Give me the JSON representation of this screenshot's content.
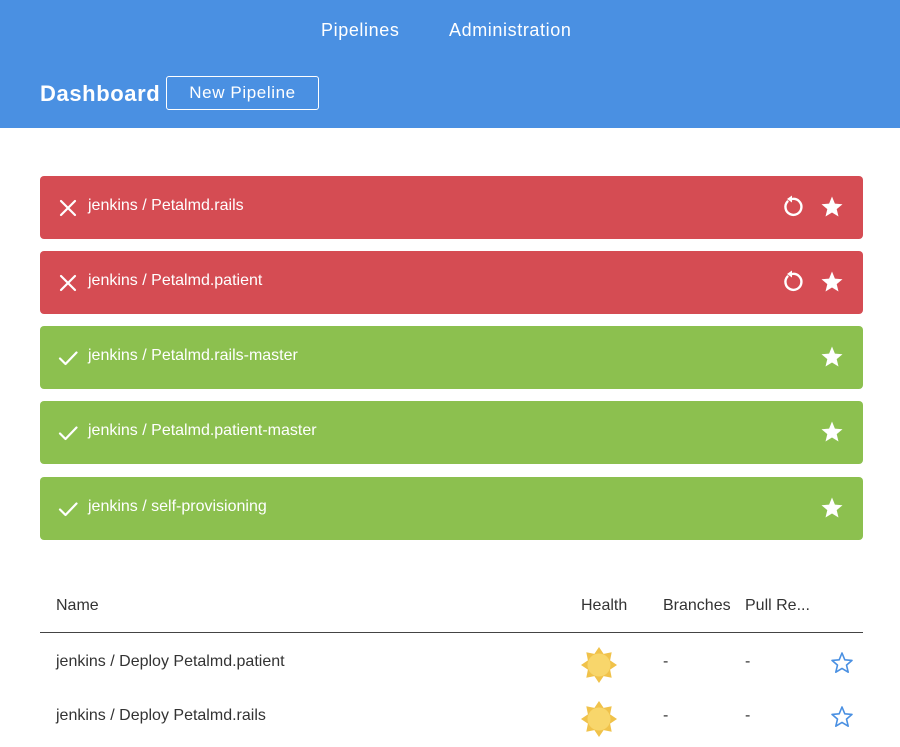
{
  "header": {
    "nav": [
      {
        "label": "Pipelines"
      },
      {
        "label": "Administration"
      }
    ],
    "title": "Dashboard",
    "new_pipeline_label": "New Pipeline"
  },
  "colors": {
    "header": "#4a90e2",
    "failure": "#d54c53",
    "success": "#8cc04f",
    "star_outline": "#4a90e2",
    "health_sunny": "#f8d66b"
  },
  "favorites": [
    {
      "name": "jenkins / Petalmd.rails",
      "status": "failure",
      "status_icon": "x-icon",
      "replay": true
    },
    {
      "name": "jenkins / Petalmd.patient",
      "status": "failure",
      "status_icon": "x-icon",
      "replay": true
    },
    {
      "name": "jenkins / Petalmd.rails-master",
      "status": "success",
      "status_icon": "check-icon",
      "replay": false
    },
    {
      "name": "jenkins / Petalmd.patient-master",
      "status": "success",
      "status_icon": "check-icon",
      "replay": false
    },
    {
      "name": "jenkins / self-provisioning",
      "status": "success",
      "status_icon": "check-icon",
      "replay": false
    }
  ],
  "table": {
    "columns": [
      "Name",
      "Health",
      "Branches",
      "Pull Re..."
    ],
    "rows": [
      {
        "name": "jenkins / Deploy Petalmd.patient",
        "health_icon": "sunny-weather-icon",
        "branches": "-",
        "pull_requests": "-",
        "favorite_icon": "star-outline-icon"
      },
      {
        "name": "jenkins / Deploy Petalmd.rails",
        "health_icon": "sunny-weather-icon",
        "branches": "-",
        "pull_requests": "-",
        "favorite_icon": "star-outline-icon"
      }
    ]
  }
}
